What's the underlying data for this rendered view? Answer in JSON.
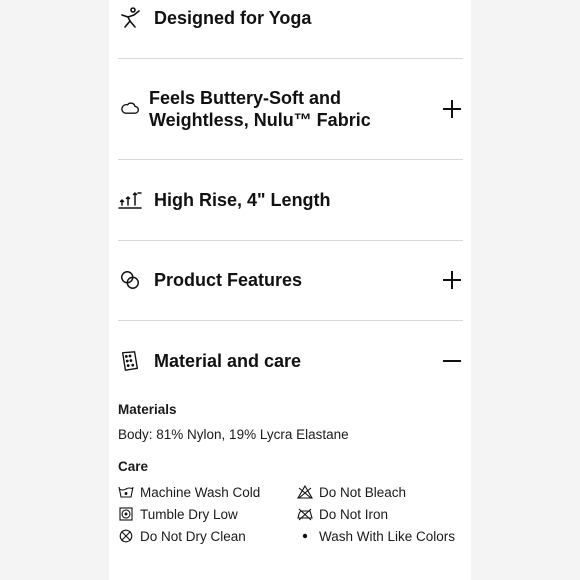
{
  "sections": [
    {
      "title": "Designed for Yoga",
      "icon": "yoga-pose-icon",
      "toggle": "none"
    },
    {
      "title": "Feels Buttery-Soft and Weightless, Nulu™ Fabric",
      "icon": "cloud-icon",
      "toggle": "+"
    },
    {
      "title": "High Rise, 4\" Length",
      "icon": "rise-arrows-icon",
      "toggle": "none"
    },
    {
      "title": "Product Features",
      "icon": "overlap-circles-icon",
      "toggle": "+"
    },
    {
      "title": "Material and care",
      "icon": "fabric-swatch-icon",
      "toggle": "−"
    }
  ],
  "materials": {
    "label": "Materials",
    "body": "Body: 81% Nylon, 19% Lycra Elastane"
  },
  "care": {
    "label": "Care",
    "items": [
      {
        "text": "Machine Wash Cold",
        "icon": "wash-cold-icon"
      },
      {
        "text": "Do Not Bleach",
        "icon": "no-bleach-icon"
      },
      {
        "text": "Tumble Dry Low",
        "icon": "tumble-dry-low-icon"
      },
      {
        "text": "Do Not Iron",
        "icon": "no-iron-icon"
      },
      {
        "text": "Do Not Dry Clean",
        "icon": "no-dry-clean-icon"
      },
      {
        "text": "Wash With Like Colors",
        "icon": "bullet-icon"
      }
    ]
  }
}
